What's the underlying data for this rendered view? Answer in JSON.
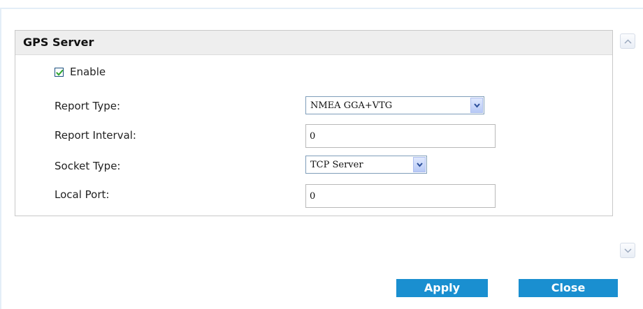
{
  "panel": {
    "title": "GPS Server",
    "enable": {
      "label": "Enable",
      "checked": true
    },
    "fields": {
      "report_type": {
        "label": "Report Type:",
        "value": "NMEA GGA+VTG"
      },
      "report_interval": {
        "label": "Report Interval:",
        "value": "0"
      },
      "socket_type": {
        "label": "Socket Type:",
        "value": "TCP Server"
      },
      "local_port": {
        "label": "Local Port:",
        "value": "0"
      }
    }
  },
  "buttons": {
    "apply_label": "Apply",
    "close_label": "Close"
  },
  "colors": {
    "button": "#1a8fd0",
    "header": "#eeeeee",
    "checkmark": "#2fa62f",
    "dropdown_arrow": "#2c4f9a"
  },
  "icons": {
    "checkbox": "checkmark-icon",
    "dropdown": "chevron-down-icon",
    "scroll_up": "chevron-up-icon",
    "scroll_down": "chevron-down-icon"
  }
}
